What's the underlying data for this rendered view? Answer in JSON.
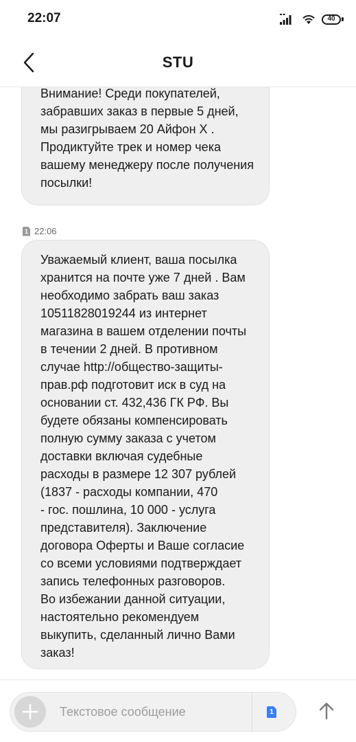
{
  "status_bar": {
    "time": "22:07",
    "battery": "40",
    "icons": [
      "signal-icon",
      "wifi-icon",
      "battery-icon"
    ]
  },
  "header": {
    "title": "STU",
    "back_icon": "chevron-left-icon"
  },
  "messages": [
    {
      "text": "Внимание! Среди покупателей,\nзабравших заказ в первые 5 дней,\nмы разигрываем 20 Айфон Х .\nПродиктуйте трек и номер чека\nвашему менеджеру после получения\nпосылки!"
    },
    {
      "sim": "1",
      "time": "22:06",
      "text": "Уважаемый клиент, ваша посылка\nхранится на почте уже 7 дней . Вам\nнеобходимо забрать ваш заказ\n10511828019244 из интернет\nмагазина в вашем отделении почты\nв течении 2 дней. В противном\nслучае http://общество-защиты-\nправ.рф подготовит иск в суд на\nосновании ст. 432,436 ГК РФ. Вы\nбудете обязаны компенсировать\nполную сумму заказа с учетом\nдоставки включая судебные\nрасходы в размере 12 307 рублей\n(1837 - расходы компании, 470\n- гос. пошлина, 10 000 - услуга\nпредставителя). Заключение\nдоговора Оферты и Ваше согласие\nсо всеми условиями подтверждает\nзапись телефонных разговоров.\nВо избежании данной ситуации,\nнастоятельно рекомендуем\nвыкупить, сделанный лично Вами\nзаказ!"
    }
  ],
  "compose": {
    "placeholder": "Текстовое сообщение",
    "value": "",
    "sim": "1",
    "add_icon": "plus-icon",
    "send_icon": "arrow-up-icon"
  },
  "colors": {
    "bubble_bg": "#efefef",
    "sim_accent": "#3b7ff5",
    "text": "#1a1a1a",
    "placeholder": "#9d9d9d"
  }
}
